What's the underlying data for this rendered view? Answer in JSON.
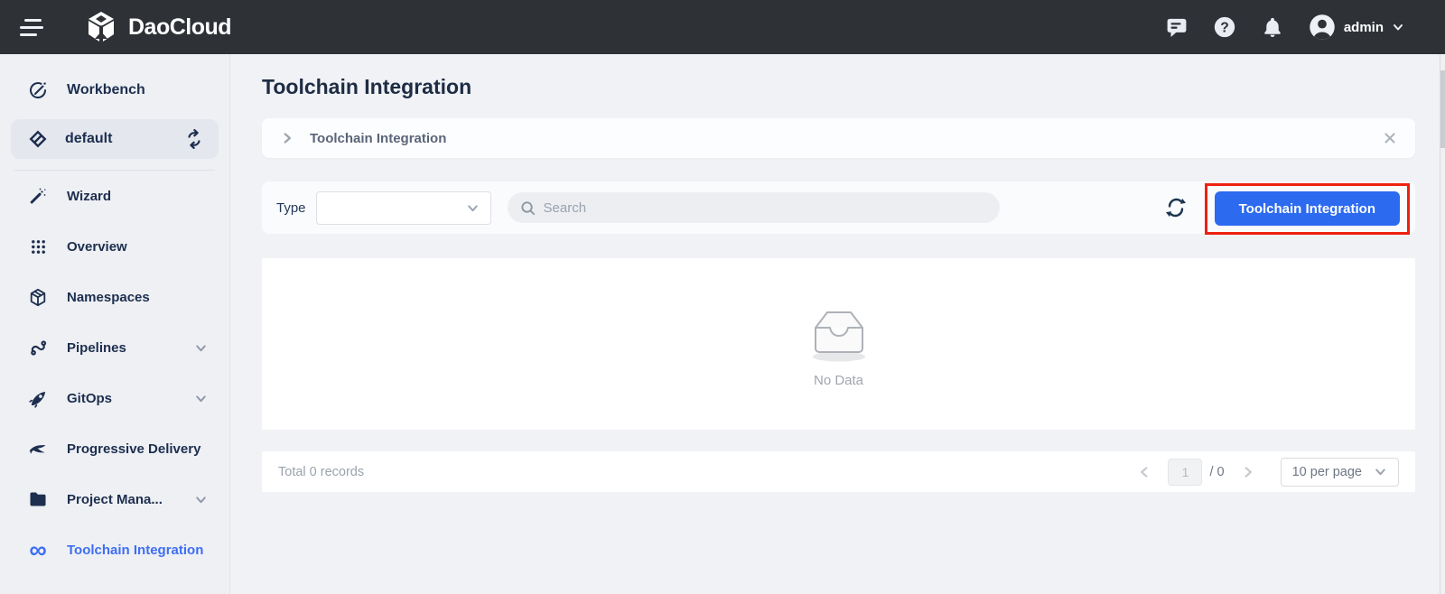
{
  "header": {
    "brand": "DaoCloud",
    "user": "admin"
  },
  "sidebar": {
    "items": [
      {
        "label": "Workbench",
        "icon": "workbench-icon"
      },
      {
        "label": "default",
        "icon": "workspace-icon",
        "state": "selected"
      },
      {
        "label": "Wizard",
        "icon": "wand-icon"
      },
      {
        "label": "Overview",
        "icon": "grid-icon"
      },
      {
        "label": "Namespaces",
        "icon": "cube-icon"
      },
      {
        "label": "Pipelines",
        "icon": "pipeline-icon",
        "expandable": true
      },
      {
        "label": "GitOps",
        "icon": "rocket-icon",
        "expandable": true
      },
      {
        "label": "Progressive Delivery",
        "icon": "bird-icon"
      },
      {
        "label": "Project Mana...",
        "icon": "folder-icon",
        "expandable": true
      },
      {
        "label": "Toolchain Integration",
        "icon": "infinity-icon",
        "state": "active"
      }
    ]
  },
  "page": {
    "title": "Toolchain Integration",
    "tab_label": "Toolchain Integration"
  },
  "filters": {
    "type_label": "Type",
    "type_value": "",
    "search_placeholder": "Search",
    "action_button": "Toolchain Integration"
  },
  "empty_state": {
    "message": "No Data"
  },
  "pagination": {
    "total_text": "Total 0 records",
    "current_page": "1",
    "total_pages_text": "/ 0",
    "page_size": "10 per page"
  },
  "colors": {
    "header_bg": "#2e3237",
    "accent_blue": "#2c6af0",
    "active_link_blue": "#3e6ef5",
    "annotation_red": "#ee2110",
    "sidebar_bg": "#eef0f4"
  }
}
